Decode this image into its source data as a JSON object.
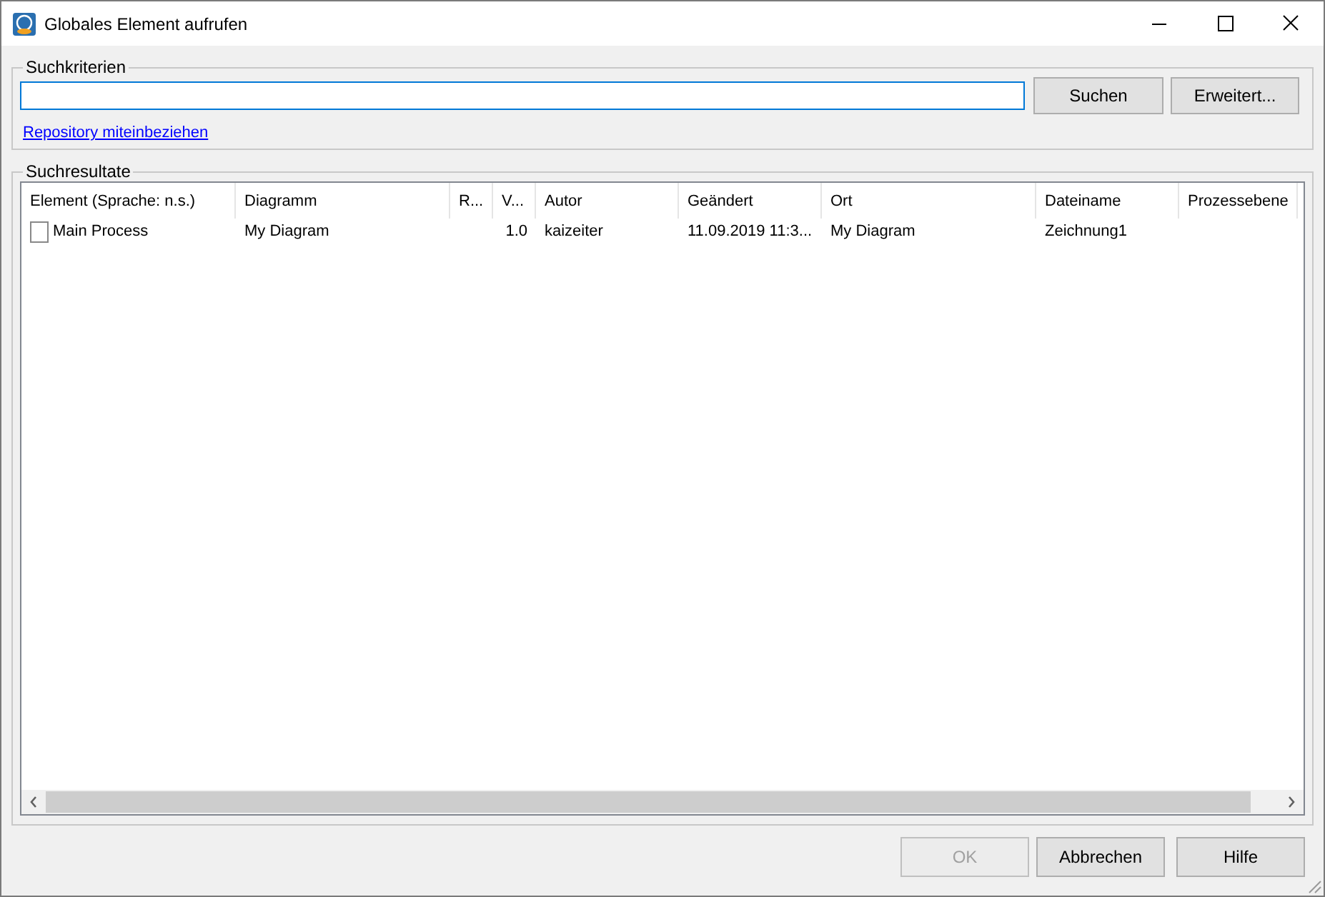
{
  "window": {
    "title": "Globales Element aufrufen"
  },
  "search_criteria": {
    "legend": "Suchkriterien",
    "buttons": [
      {
        "label": "Suchen"
      },
      {
        "label": "Erweitert..."
      }
    ],
    "link": "Repository miteinbeziehen"
  },
  "results": {
    "legend": "Suchresultate",
    "columns": [
      "Element (Sprache: n.s.)",
      "Diagramm",
      "R...",
      "V...",
      "Autor",
      "Geändert",
      "Ort",
      "Dateiname",
      "Prozessebene"
    ],
    "rows": [
      {
        "checked": false,
        "cells": [
          "Main Process",
          "My Diagram",
          "",
          "1.0",
          "kaizeiter",
          "11.09.2019 11:3...",
          "My Diagram",
          "Zeichnung1",
          ""
        ]
      }
    ]
  },
  "buttons": [
    {
      "label": "OK",
      "disabled": true
    },
    {
      "label": "Abbrechen",
      "disabled": false
    },
    {
      "label": "Hilfe",
      "disabled": false
    }
  ]
}
